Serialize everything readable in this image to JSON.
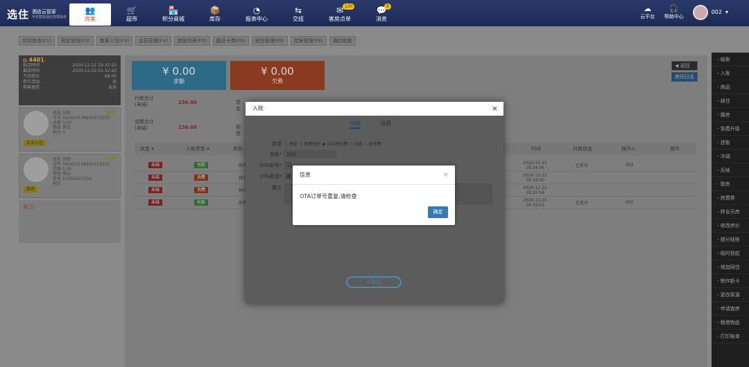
{
  "app": {
    "logo_big": "选住",
    "logo_line1": "酒店云管家",
    "logo_line2": "手机智能酒店管理系统"
  },
  "nav": [
    {
      "label": "宾客",
      "icon": "👥"
    },
    {
      "label": "超市",
      "icon": "🛒"
    },
    {
      "label": "积分商城",
      "icon": "🏪"
    },
    {
      "label": "库存",
      "icon": "📦"
    },
    {
      "label": "报表中心",
      "icon": "◔"
    },
    {
      "label": "交班",
      "icon": "⇆"
    },
    {
      "label": "客房点单",
      "icon": "✉",
      "badge": "130"
    },
    {
      "label": "消息",
      "icon": "💬",
      "badge": "8"
    }
  ],
  "tools": [
    {
      "label": "云平台",
      "icon": "☁"
    },
    {
      "label": "帮助中心",
      "icon": "🎧"
    }
  ],
  "user": {
    "name": "002"
  },
  "tabs": [
    "实时房态(F1)",
    "预定管理(F2)",
    "散客入住(F3)",
    "会员管理(F4)",
    "宾客列表(F5)",
    "翻还卡券(F6)",
    "预住管理(F8)",
    "挂账管理(F9)",
    "酒店收款"
  ],
  "room": {
    "number": "4401",
    "rows": [
      {
        "k": "抵店时间",
        "v": "2020-12-21 19:32:20"
      },
      {
        "k": "离店时间",
        "v": "2020-12-22 01:32:20"
      },
      {
        "k": "今日房价",
        "v": "68.00"
      },
      {
        "k": "参与活动",
        "v": "无"
      },
      {
        "k": "宾客类型",
        "v": "会员"
      }
    ]
  },
  "guests": [
    {
      "lines": [
        "姓名 刘帅",
        "卡号 342623198910155555",
        "余额 0.00",
        "等级 黑钻",
        "积分 0"
      ],
      "button": "会员入住"
    },
    {
      "lines": [
        "姓名 刘帅",
        "证件 342623198910155555",
        "余额 0.00",
        "等级 黑钻",
        "手机 15056972306",
        "积分"
      ],
      "button": "修改"
    }
  ],
  "vip": "VIP",
  "remark_label": "备注:",
  "cards": {
    "balance_amount": "¥ 0.00",
    "balance_label": "余额",
    "owe_amount": "¥ 0.00",
    "owe_label": "欠费"
  },
  "totals": {
    "pay_label_1": "付款合计",
    "pay_label_2": "(未结)",
    "pay_value": "136.00",
    "consume_label_1": "消费合计",
    "consume_label_2": "(未结)",
    "consume_value": "136.00",
    "cash_label": "现金",
    "reserve_label": "预授"
  },
  "table": {
    "headers": [
      "状态 ▾",
      "入账类型 ▾",
      "类型",
      "时间",
      "付款状态",
      "操作人",
      "操作"
    ],
    "rows": [
      {
        "status": "未结",
        "type": "付款",
        "name": "房费",
        "time1": "2020-12-21",
        "time2": "19:34:06",
        "pay": "已支付",
        "op": "002"
      },
      {
        "status": "未结",
        "type": "消费",
        "name": "钟点",
        "time1": "2020-12-21",
        "time2": "19:34:00",
        "pay": "",
        "op": ""
      },
      {
        "status": "未结",
        "type": "消费",
        "name": "钟点",
        "time1": "2020-12-21",
        "time2": "19:33:59",
        "pay": "",
        "op": ""
      },
      {
        "status": "未结",
        "type": "付款",
        "name": "房费",
        "time1": "2020-12-21",
        "time2": "19:33:55",
        "pay": "已支付",
        "op": "002"
      }
    ]
  },
  "right_buttons": {
    "back": "◀ 返回",
    "log": "房间日志"
  },
  "sidebar": [
    "结账",
    "入账",
    "商品",
    "续住",
    "换房",
    "免费升级",
    "挂账",
    "冲调",
    "反结",
    "联房",
    "房费券",
    "转全天房",
    "修改房价",
    "部分结账",
    "临时挂起",
    "增加同住",
    "制作新卡",
    "更改客源",
    "申请查房",
    "租借物品",
    "打印账单"
  ],
  "dialog": {
    "title": "入账",
    "tab_pay": "付款",
    "tab_consume": "消费",
    "type_label": "类型",
    "type_options": [
      "押金",
      "房费预付",
      "OTA预付费",
      "全部",
      "现收费"
    ],
    "amount_label": "金额*",
    "amount_value": "100",
    "ota_order_label": "OTA单号*",
    "ota_order_value": "11",
    "ota_channel_label": "OTA渠道*",
    "ota_channel_value": "美",
    "remark_label": "备注",
    "confirm": "✔确定"
  },
  "alert": {
    "title": "信息",
    "message": "OTA订单号重复,请检查",
    "ok": "确定"
  }
}
